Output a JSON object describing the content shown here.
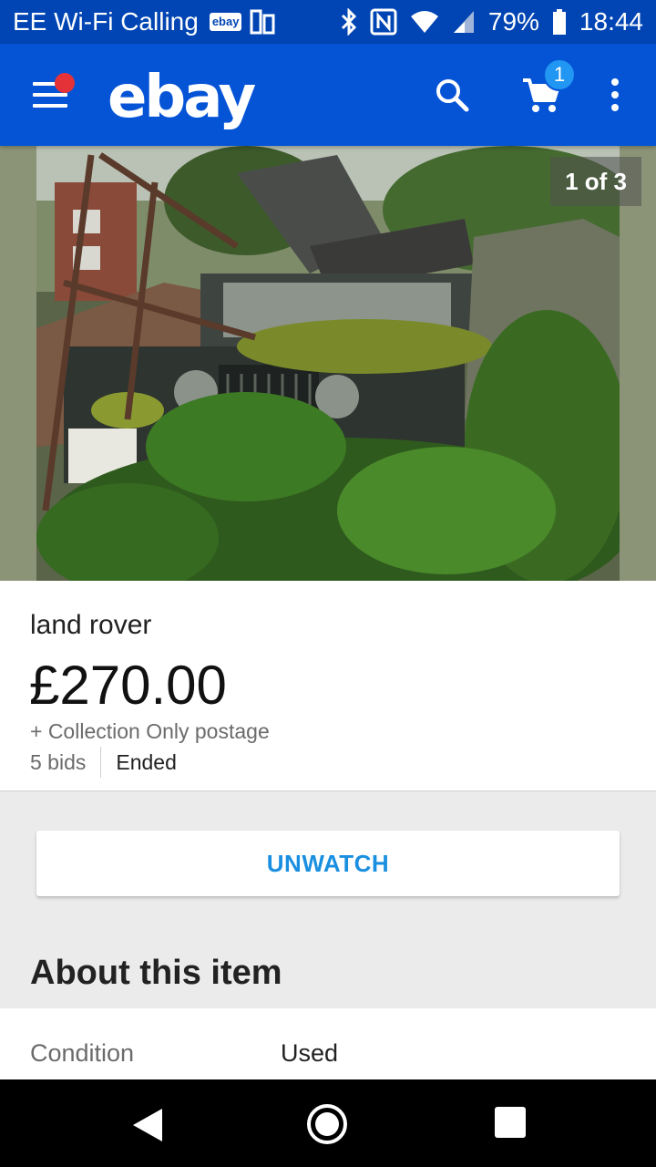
{
  "status_bar": {
    "carrier": "EE Wi-Fi Calling",
    "badge": "ebay",
    "battery": "79%",
    "time": "18:44"
  },
  "app_bar": {
    "logo": "ebay",
    "cart_count": "1",
    "icons": [
      "menu-icon",
      "search-icon",
      "cart-icon",
      "more-vert-icon"
    ],
    "colors": {
      "bar": "#0654d6",
      "status": "#0045b3",
      "notification_dot": "#e53238",
      "cart_badge": "#2196f3"
    }
  },
  "gallery": {
    "counter": "1 of 3"
  },
  "listing": {
    "title": "land rover",
    "price": "£270.00",
    "postage": "+ Collection Only postage",
    "bids": "5 bids",
    "status": "Ended"
  },
  "actions": {
    "unwatch_label": "UNWATCH",
    "accent": "#1a8fe0"
  },
  "about": {
    "heading": "About this item",
    "condition_label": "Condition",
    "condition_value": "Used"
  },
  "nav": {
    "icons": [
      "back-icon",
      "home-icon",
      "recents-icon"
    ]
  }
}
